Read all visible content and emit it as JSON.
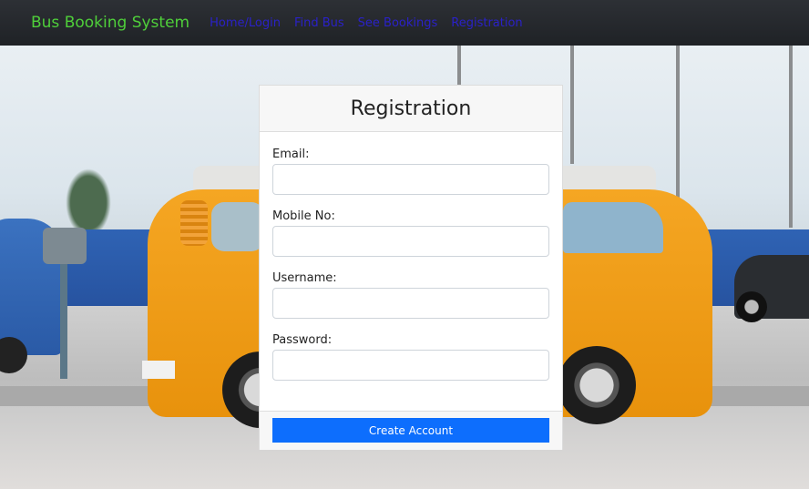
{
  "navbar": {
    "brand": "Bus Booking System",
    "links": [
      "Home/Login",
      "Find Bus",
      "See Bookings",
      "Registration"
    ]
  },
  "form": {
    "title": "Registration",
    "fields": [
      {
        "label": "Email:",
        "value": "",
        "placeholder": ""
      },
      {
        "label": "Mobile No:",
        "value": "",
        "placeholder": ""
      },
      {
        "label": "Username:",
        "value": "",
        "placeholder": ""
      },
      {
        "label": "Password:",
        "value": "",
        "placeholder": ""
      }
    ],
    "submit_label": "Create Account"
  },
  "colors": {
    "navbar_bg": "#25282c",
    "brand": "#4fcf3a",
    "nav_link": "#2a21c8",
    "primary_button": "#0d6efd"
  }
}
